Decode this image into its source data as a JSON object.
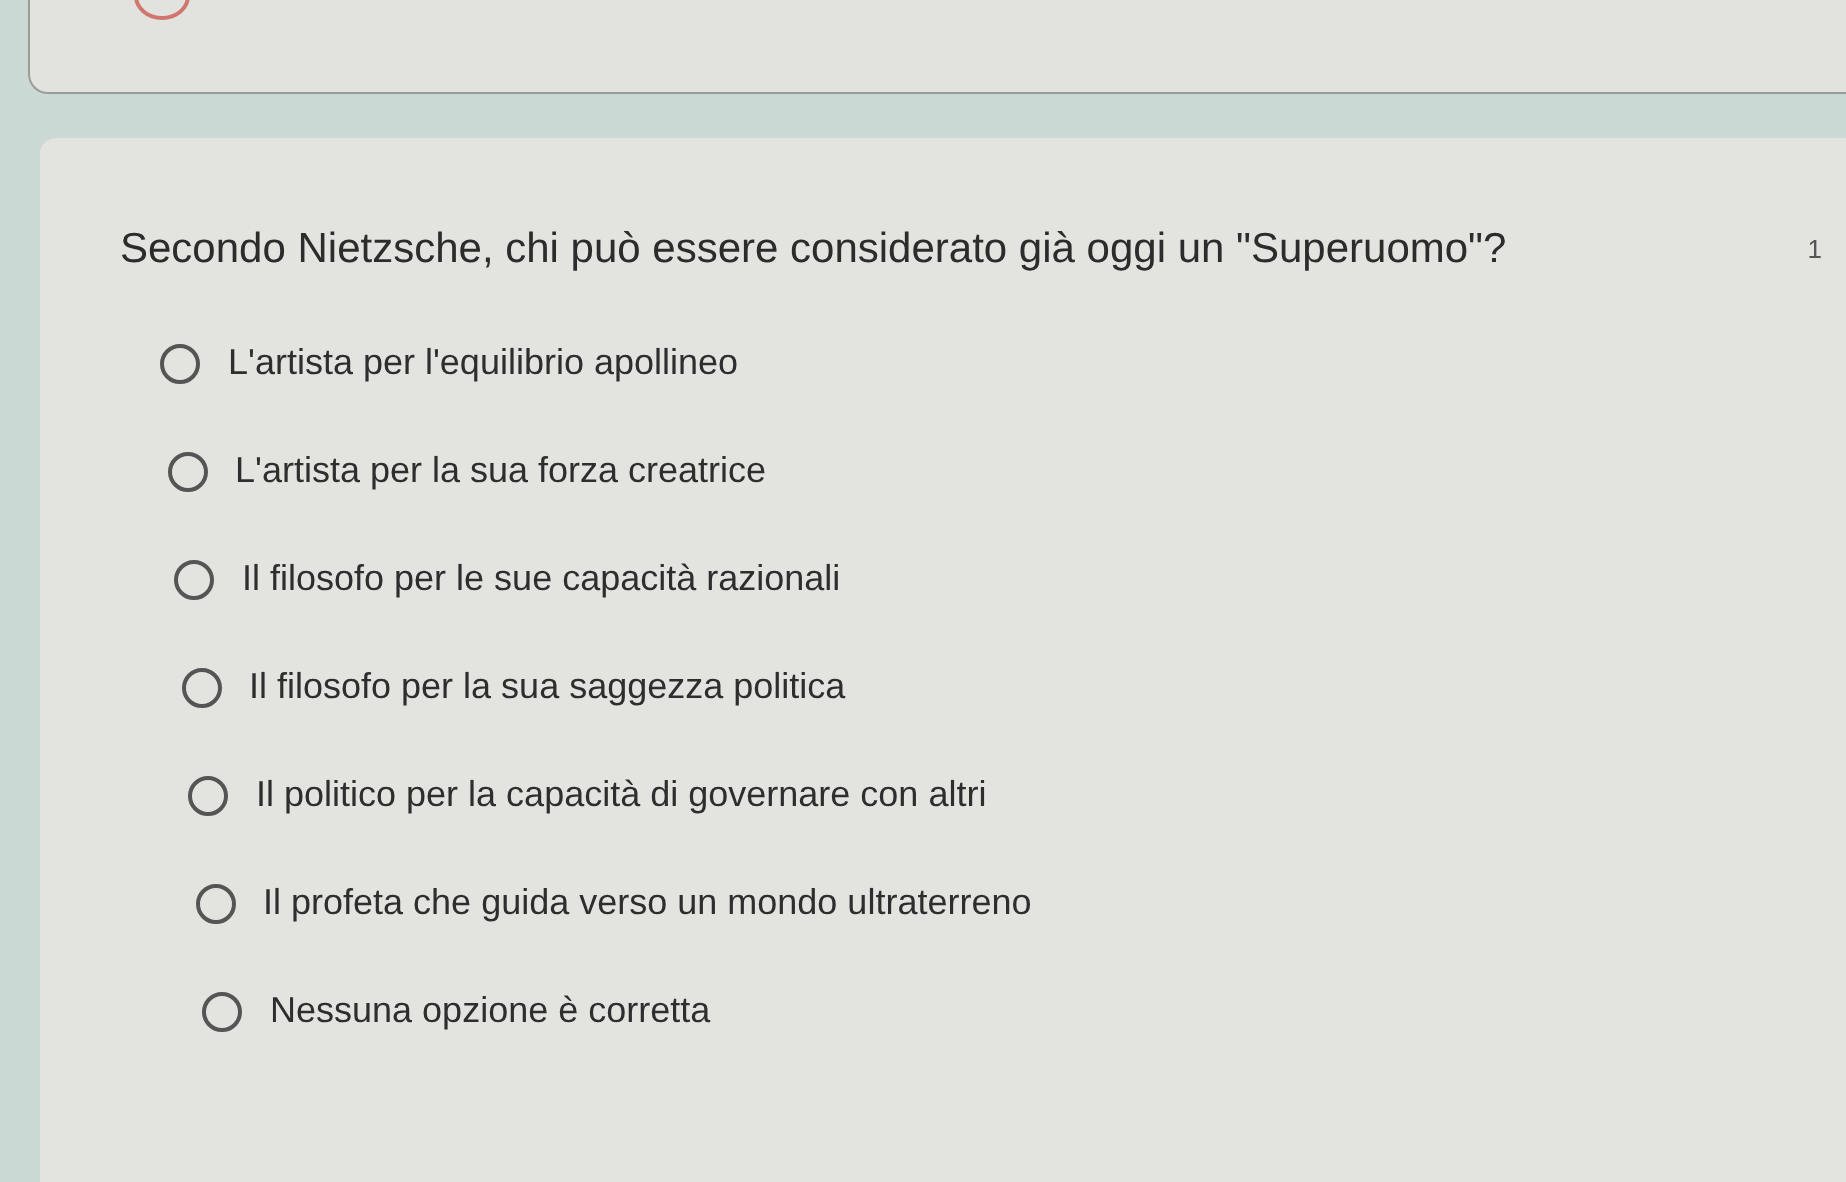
{
  "question": {
    "title": "Secondo Nietzsche, chi può essere considerato già oggi un \"Superuomo\"?",
    "points": "1",
    "options": [
      {
        "label": "L'artista per l'equilibrio apollineo",
        "selected": false
      },
      {
        "label": "L'artista per la sua forza creatrice",
        "selected": false
      },
      {
        "label": "Il filosofo per le sue capacità razionali",
        "selected": false
      },
      {
        "label": "Il filosofo per la sua saggezza politica",
        "selected": false
      },
      {
        "label": "Il politico per la capacità di governare con altri",
        "selected": false
      },
      {
        "label": "Il profeta che guida verso un mondo ultraterreno",
        "selected": false
      },
      {
        "label": "Nessuna opzione è corretta",
        "selected": false
      }
    ]
  }
}
